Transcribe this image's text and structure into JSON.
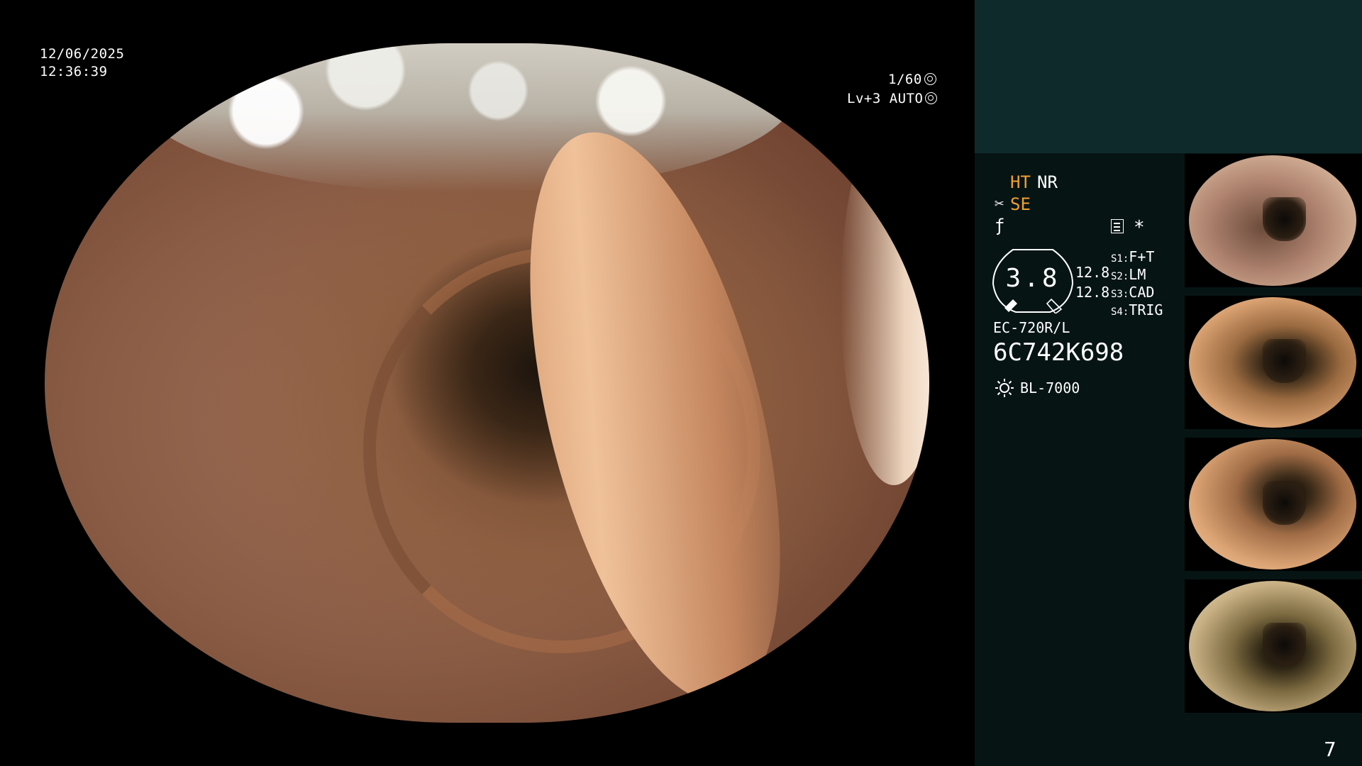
{
  "overlay": {
    "date": "12/06/2025",
    "time": "12:36:39",
    "shutter": "1/60",
    "level": "Lv+3",
    "mode": "AUTO"
  },
  "panel": {
    "ht": "HT",
    "nr": "NR",
    "se": "SE",
    "se_icon": "scissor-icon",
    "f_icon": "f-icon",
    "star": "*",
    "gauge_value": "3.8",
    "value_1": "12.8",
    "value_2": "12.8",
    "switches": [
      {
        "key": "S1:",
        "value": "F+T"
      },
      {
        "key": "S2:",
        "value": "LM"
      },
      {
        "key": "S3:",
        "value": "CAD"
      },
      {
        "key": "S4:",
        "value": "TRIG"
      }
    ],
    "scope_model": "EC-720R/L",
    "scope_serial": "6C742K698",
    "light_source": "BL-7000"
  },
  "colors": {
    "accent_orange": "#f0a030",
    "panel_top": "#0f2a2a",
    "panel_bg": "#071414"
  },
  "page_number": "7"
}
